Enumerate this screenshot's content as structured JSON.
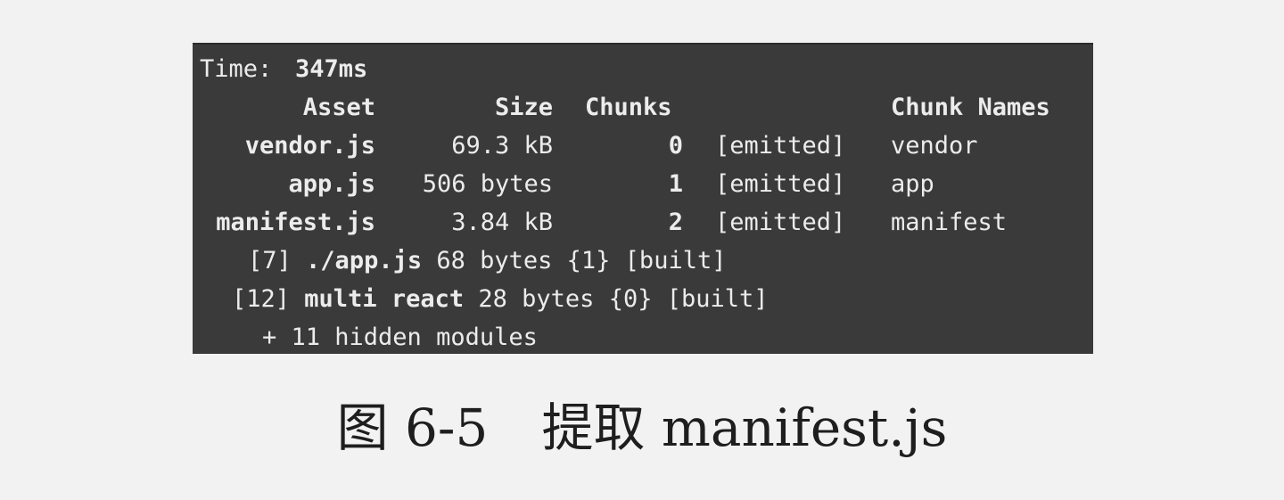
{
  "terminal": {
    "time_label": "Time: ",
    "time_value": "347ms",
    "headers": {
      "asset": "Asset",
      "size": "Size",
      "chunks": "Chunks",
      "chunk_names": "Chunk Names"
    },
    "rows": [
      {
        "asset": "vendor.js",
        "size": "69.3 kB",
        "chunk": "0",
        "status": "[emitted]",
        "name": "vendor"
      },
      {
        "asset": "app.js",
        "size": "506 bytes",
        "chunk": "1",
        "status": "[emitted]",
        "name": "app"
      },
      {
        "asset": "manifest.js",
        "size": "3.84 kB",
        "chunk": "2",
        "status": "[emitted]",
        "name": "manifest"
      }
    ],
    "modules": [
      {
        "id": "[7]",
        "name": "./app.js",
        "rest": "68 bytes {1} [built]"
      },
      {
        "id": "[12]",
        "kw": "multi",
        "name": "react",
        "rest": "28 bytes {0} [built]"
      }
    ],
    "hidden": "+ 11 hidden modules"
  },
  "caption": {
    "figure": "图 6-5",
    "title": "提取 manifest.js"
  }
}
